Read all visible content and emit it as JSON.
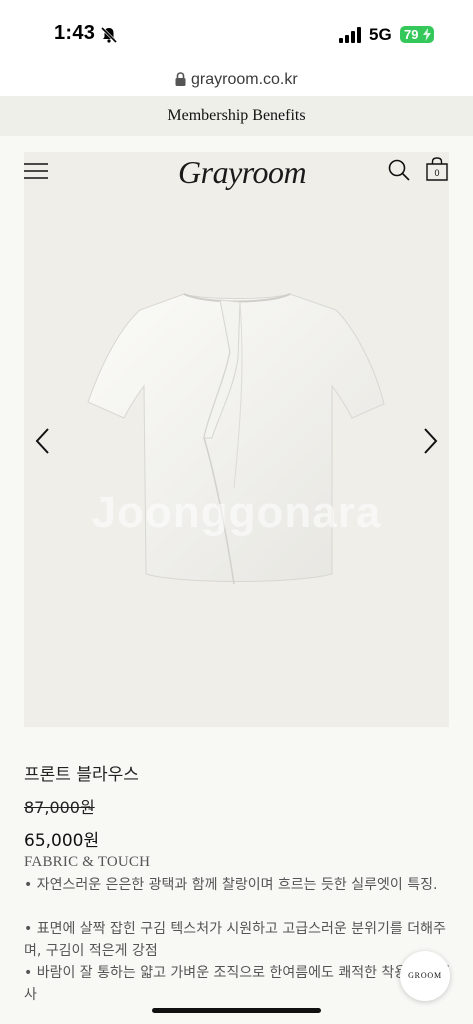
{
  "status_bar": {
    "time": "1:43",
    "network": "5G",
    "battery": "79"
  },
  "browser": {
    "url": "grayroom.co.kr"
  },
  "promo_bar": {
    "label": "Membership Benefits"
  },
  "header": {
    "logo": "Grayroom",
    "cart_count": "0"
  },
  "gallery": {
    "watermark": "Joonggonara"
  },
  "product": {
    "name": "프론트 블라우스",
    "price_original": "87,000원",
    "price_sale": "65,000원",
    "fabric_title": "FABRIC & TOUCH",
    "descriptions": [
      "• 자연스러운 은은한 광택과 함께 찰랑이며 흐르는 듯한 실루엣이 특징.",
      "• 표면에 살짝 잡힌 구김 텍스처가 시원하고 고급스러운 분위기를 더해주며, 구김이 적은게 강점",
      "• 바람이 잘 통하는 얇고 가벼운 조직으로 한여름에도 쾌적한 착용감을 선사"
    ]
  },
  "floating_badge": {
    "label": "GROOM"
  },
  "colors": {
    "battery": "#34c759",
    "page_background": "#f8f8f5",
    "panel_background": "#efeee8"
  }
}
